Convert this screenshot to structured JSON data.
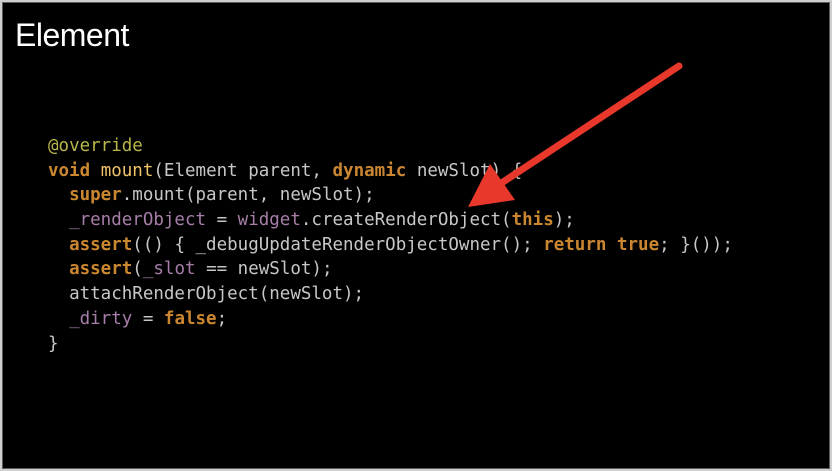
{
  "slide": {
    "title": "Element"
  },
  "code": {
    "lines": [
      [
        {
          "t": "@override",
          "k": "annotation"
        }
      ],
      [
        {
          "t": "void",
          "k": "keyword"
        },
        {
          "t": " ",
          "k": "plain"
        },
        {
          "t": "mount",
          "k": "func"
        },
        {
          "t": "(Element parent, ",
          "k": "plain"
        },
        {
          "t": "dynamic",
          "k": "keyword"
        },
        {
          "t": " newSlot) {",
          "k": "plain"
        }
      ],
      [
        {
          "t": "  ",
          "k": "plain"
        },
        {
          "t": "super",
          "k": "keyword"
        },
        {
          "t": ".mount(parent, newSlot);",
          "k": "plain"
        }
      ],
      [
        {
          "t": "  ",
          "k": "plain"
        },
        {
          "t": "_renderObject",
          "k": "field"
        },
        {
          "t": " = ",
          "k": "plain"
        },
        {
          "t": "widget",
          "k": "field"
        },
        {
          "t": ".createRenderObject(",
          "k": "plain"
        },
        {
          "t": "this",
          "k": "keyword"
        },
        {
          "t": ");",
          "k": "plain"
        }
      ],
      [
        {
          "t": "  ",
          "k": "plain"
        },
        {
          "t": "assert",
          "k": "keyword"
        },
        {
          "t": "(() { _debugUpdateRenderObjectOwner(); ",
          "k": "plain"
        },
        {
          "t": "return",
          "k": "keyword"
        },
        {
          "t": " ",
          "k": "plain"
        },
        {
          "t": "true",
          "k": "keyword"
        },
        {
          "t": "; }());",
          "k": "plain"
        }
      ],
      [
        {
          "t": "  ",
          "k": "plain"
        },
        {
          "t": "assert",
          "k": "keyword"
        },
        {
          "t": "(",
          "k": "plain"
        },
        {
          "t": "_slot",
          "k": "field"
        },
        {
          "t": " == newSlot);",
          "k": "plain"
        }
      ],
      [
        {
          "t": "  attachRenderObject(newSlot);",
          "k": "plain"
        }
      ],
      [
        {
          "t": "  ",
          "k": "plain"
        },
        {
          "t": "_dirty",
          "k": "field"
        },
        {
          "t": " = ",
          "k": "plain"
        },
        {
          "t": "false",
          "k": "keyword"
        },
        {
          "t": ";",
          "k": "plain"
        }
      ],
      [
        {
          "t": "}",
          "k": "plain"
        }
      ]
    ]
  },
  "colors": {
    "background": "#000000",
    "plain": "#c7c7c7",
    "keyword": "#cb8730",
    "annotation": "#b9b64a",
    "function": "#f0c36b",
    "field": "#a67ea8",
    "arrow": "#e8382c"
  },
  "annotation_arrow": {
    "icon": "red-pointer-arrow",
    "points_to": "createRenderObject"
  }
}
